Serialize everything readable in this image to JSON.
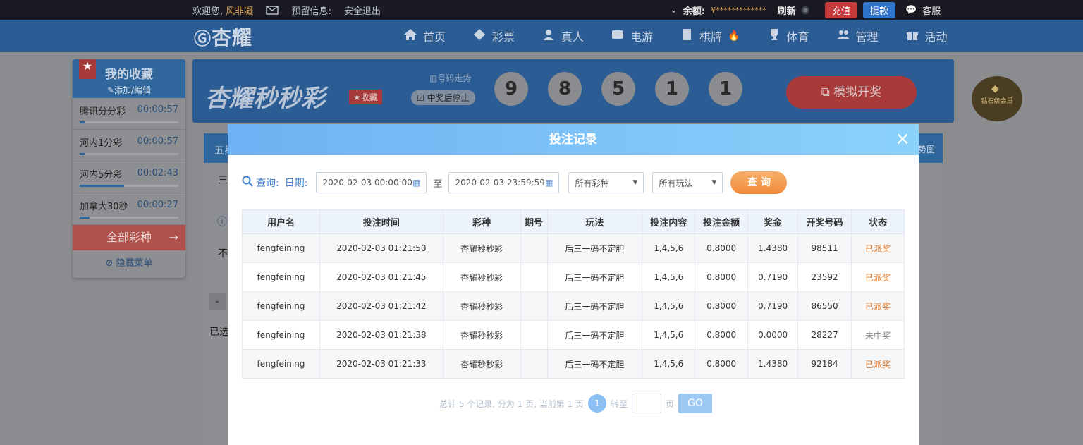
{
  "topbar": {
    "welcome": "欢迎您,",
    "username": "风非凝",
    "reserved_info": "预留信息:",
    "logout": "安全退出",
    "balance_label": "余额:",
    "balance_value": "¥*************",
    "refresh": "刷新",
    "recharge": "充值",
    "withdraw": "提款",
    "service": "客服"
  },
  "nav": {
    "logo": "杏耀",
    "items": [
      {
        "label": "首页",
        "icon": "home-icon"
      },
      {
        "label": "彩票",
        "icon": "diamond-icon"
      },
      {
        "label": "真人",
        "icon": "person-icon"
      },
      {
        "label": "电游",
        "icon": "gamepad-icon"
      },
      {
        "label": "棋牌",
        "icon": "cards-icon"
      },
      {
        "label": "体育",
        "icon": "trophy-icon"
      },
      {
        "label": "管理",
        "icon": "users-icon"
      },
      {
        "label": "活动",
        "icon": "gift-icon"
      }
    ]
  },
  "favorites": {
    "title": "我的收藏",
    "edit": "添加/编辑",
    "items": [
      {
        "name": "腾讯分分彩",
        "time": "00:00:57",
        "progress": 0.05
      },
      {
        "name": "河内1分彩",
        "time": "00:00:57",
        "progress": 0.05
      },
      {
        "name": "河内5分彩",
        "time": "00:02:43",
        "progress": 0.45
      },
      {
        "name": "加拿大30秒",
        "time": "00:00:27",
        "progress": 0.1
      }
    ],
    "all_label": "全部彩种",
    "hide_label": "隐藏菜单"
  },
  "banner": {
    "title": "杏耀秒秒彩",
    "fav_btn": "收藏",
    "trend": "号码走势",
    "stop_after_win": "中奖后停止",
    "balls": [
      "9",
      "8",
      "5",
      "1",
      "1"
    ],
    "simulate": "模拟开奖",
    "badge": "钻石级会员"
  },
  "background": {
    "tab_frag": "五星",
    "frag1": "三",
    "frag2": "不",
    "frag3": "-",
    "frag4": "已选",
    "chart_frag": "势图"
  },
  "modal": {
    "title": "投注记录",
    "close": "×",
    "query_label": "查询:",
    "date_label": "日期:",
    "date_from": "2020-02-03 00:00:00",
    "to": "至",
    "date_to": "2020-02-03 23:59:59",
    "lottery_select": "所有彩种",
    "play_select": "所有玩法",
    "query_btn": "查 询",
    "columns": [
      "用户名",
      "投注时间",
      "彩种",
      "期号",
      "玩法",
      "投注内容",
      "投注金额",
      "奖金",
      "开奖号码",
      "状态"
    ],
    "rows": [
      {
        "user": "fengfeining",
        "time": "2020-02-03 01:21:50",
        "lottery": "杏耀秒秒彩",
        "issue": "",
        "play": "后三一码不定胆",
        "content": "1,4,5,6",
        "amount": "0.8000",
        "prize": "1.4380",
        "number": "98511",
        "status": "已派奖"
      },
      {
        "user": "fengfeining",
        "time": "2020-02-03 01:21:45",
        "lottery": "杏耀秒秒彩",
        "issue": "",
        "play": "后三一码不定胆",
        "content": "1,4,5,6",
        "amount": "0.8000",
        "prize": "0.7190",
        "number": "23592",
        "status": "已派奖"
      },
      {
        "user": "fengfeining",
        "time": "2020-02-03 01:21:42",
        "lottery": "杏耀秒秒彩",
        "issue": "",
        "play": "后三一码不定胆",
        "content": "1,4,5,6",
        "amount": "0.8000",
        "prize": "0.7190",
        "number": "86550",
        "status": "已派奖"
      },
      {
        "user": "fengfeining",
        "time": "2020-02-03 01:21:38",
        "lottery": "杏耀秒秒彩",
        "issue": "",
        "play": "后三一码不定胆",
        "content": "1,4,5,6",
        "amount": "0.8000",
        "prize": "0.0000",
        "number": "28227",
        "status": "未中奖"
      },
      {
        "user": "fengfeining",
        "time": "2020-02-03 01:21:33",
        "lottery": "杏耀秒秒彩",
        "issue": "",
        "play": "后三一码不定胆",
        "content": "1,4,5,6",
        "amount": "0.8000",
        "prize": "1.4380",
        "number": "92184",
        "status": "已派奖"
      }
    ],
    "pager": {
      "summary": "总计 5 个记录, 分为 1 页, 当前第 1 页",
      "current": "1",
      "goto": "转至",
      "page_unit": "页",
      "go": "GO"
    }
  },
  "colors": {
    "nav_bg": "#2b5d94",
    "accent_orange": "#f08a3a",
    "paid_status": "#e07a2a",
    "modal_header": "#7cc3f8"
  }
}
